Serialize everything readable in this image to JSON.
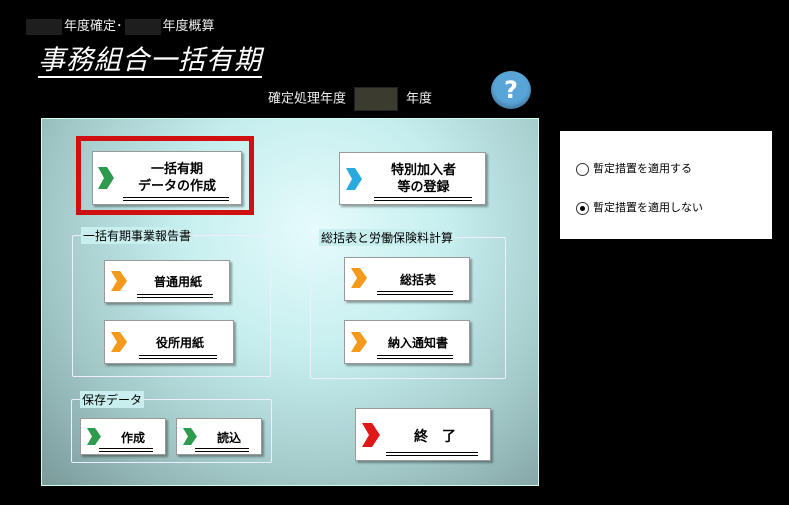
{
  "header": {
    "year_confirmed_label": "年度確定･",
    "year_estimate_label": "年度概算",
    "app_title": "事務組合一括有期",
    "process_year_label": "確定処理年度",
    "year_suffix": "年度",
    "help_label": "?"
  },
  "main": {
    "create_data_button": {
      "line1": "一括有期",
      "line2": "データの作成"
    },
    "special_member_button": {
      "line1": "特別加入者",
      "line2": "等の登録"
    },
    "report_group": {
      "title": "一括有期事業報告書",
      "normal_paper_button": "普通用紙",
      "office_paper_button": "役所用紙"
    },
    "summary_group": {
      "title": "総括表と労働保険料計算",
      "summary_button": "総括表",
      "payment_notice_button": "納入通知書"
    },
    "save_group": {
      "title": "保存データ",
      "create_button": "作成",
      "load_button": "読込"
    },
    "exit_button": "終　了"
  },
  "options": {
    "apply_label": "暫定措置を適用する",
    "not_apply_label": "暫定措置を適用しない",
    "selected": "not_apply"
  },
  "colors": {
    "green_chevron": "#2e9a4e",
    "blue_chevron": "#2aa8e0",
    "orange_chevron": "#f39a1c",
    "red_chevron": "#e01818",
    "highlight_border": "#d01010"
  }
}
